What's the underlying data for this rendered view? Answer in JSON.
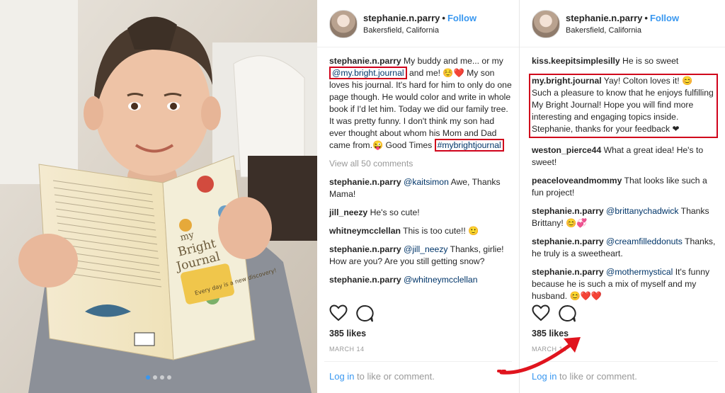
{
  "photo": {
    "book": {
      "title_my": "my",
      "title_bright": "Bright",
      "title_journal": "Journal",
      "spine": "Every day is a new discovery!"
    },
    "carousel_dots": 4,
    "active_dot": 1
  },
  "panel1": {
    "username": "stephanie.n.parry",
    "follow": "Follow",
    "location": "Bakersfield, California",
    "caption": {
      "user": "stephanie.n.parry",
      "t1": " My buddy and me... or my ",
      "mention": "@my.bright.journal",
      "t2": " and me! ☺️❤️ My son loves his journal. It's hard for him to only do one page though. He would color and write in whole book if I'd let him. Today we did our family tree. It was pretty funny. I don't think my son had ever thought about whom his Mom and Dad came from.😜 Good Times ",
      "hashtag": "#mybrightjournal"
    },
    "view_all": "View all 50 comments",
    "comments": [
      {
        "user": "stephanie.n.parry",
        "mention": "@kaitsimon",
        "text": " Awe, Thanks Mama!"
      },
      {
        "user": "jill_neezy",
        "mention": "",
        "text": " He's so cute!"
      },
      {
        "user": "whitneymcclellan",
        "mention": "",
        "text": " This is too cute!! 🙂"
      },
      {
        "user": "stephanie.n.parry",
        "mention": "@jill_neezy",
        "text": " Thanks, girlie! How are you? Are you still getting snow?"
      },
      {
        "user": "stephanie.n.parry",
        "mention": "@whitneymcclellan",
        "text": ""
      }
    ],
    "likes": "385 likes",
    "date": "MARCH 14",
    "login_link": "Log in",
    "login_rest": " to like or comment."
  },
  "panel2": {
    "username": "stephanie.n.parry",
    "follow": "Follow",
    "location": "Bakersfield, California",
    "comments": [
      {
        "user": "kiss.keepitsimplesilly",
        "mention": "",
        "text": " He is so sweet"
      },
      {
        "user": "my.bright.journal",
        "mention": "",
        "text": " Yay! Colton loves it! 😊 Such a pleasure to know that he enjoys fulfilling My Bright Journal! Hope you will find more interesting and engaging topics inside. Stephanie, thanks for your feedback ❤"
      },
      {
        "user": "weston_pierce44",
        "mention": "",
        "text": " What a great idea! He's to sweet!"
      },
      {
        "user": "peaceloveandmommy",
        "mention": "",
        "text": " That looks like such a fun project!"
      },
      {
        "user": "stephanie.n.parry",
        "mention": "@brittanychadwick",
        "text": " Thanks Brittany! 😊💞"
      },
      {
        "user": "stephanie.n.parry",
        "mention": "@creamfilleddonuts",
        "text": " Thanks, he truly is a sweetheart."
      },
      {
        "user": "stephanie.n.parry",
        "mention": "@mothermystical",
        "text": " It's funny because he is such a mix of myself and my husband. 😊❤️❤️"
      }
    ],
    "likes": "385 likes",
    "date": "MARCH 14",
    "login_link": "Log in",
    "login_rest": " to like or comment."
  },
  "colors": {
    "link": "#3897f0",
    "highlight": "#d0021b",
    "muted": "#999999",
    "mention": "#003569"
  },
  "icons": [
    "heart-icon",
    "comment-icon",
    "red-arrow-icon"
  ]
}
